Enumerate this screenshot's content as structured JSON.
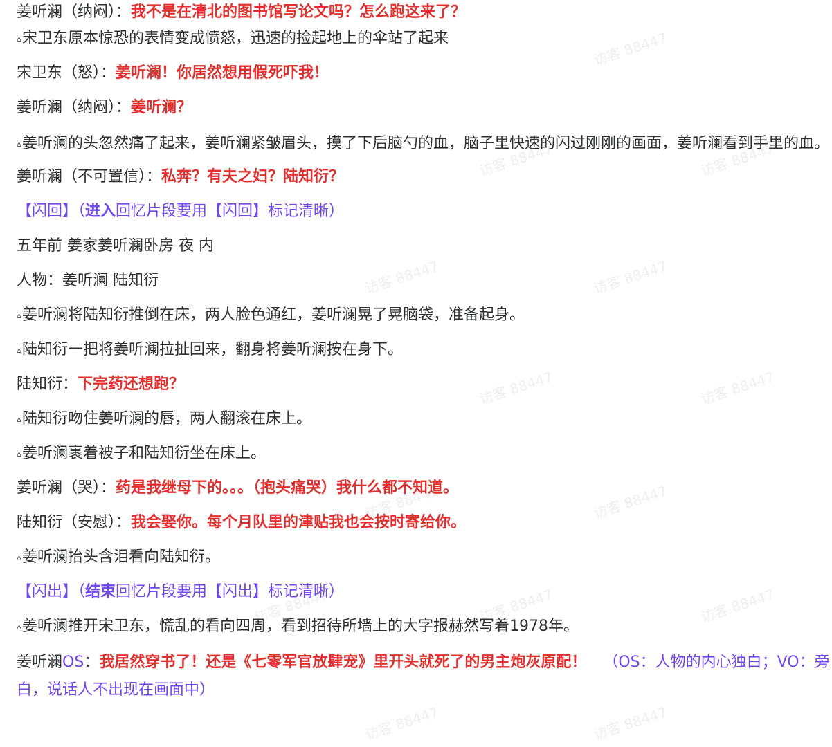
{
  "lines": {
    "l01": {
      "speaker": "姜听澜（纳闷）：",
      "dialogue": "我不是在清北的图书馆写论文吗？怎么跑这来了？"
    },
    "l02": {
      "marker": "▵",
      "action": "宋卫东原本惊恐的表情变成愤怒，迅速的捡起地上的伞站了起来"
    },
    "l03": {
      "speaker": "宋卫东（怒）：",
      "dialogue": "姜听澜！你居然想用假死吓我！"
    },
    "l04": {
      "speaker": "姜听澜（纳闷）：",
      "dialogue": "姜听澜？"
    },
    "l05": {
      "marker": "▵",
      "action": "姜听澜的头忽然痛了起来，姜听澜紧皱眉头，摸了下后脑勺的血，脑子里快速的闪过刚刚的画面，姜听澜看到手里的血。"
    },
    "l06": {
      "speaker": "姜听澜（不可置信）：",
      "dialogue": "私奔？有夫之妇？陆知衍？"
    },
    "l07": {
      "tag": "【闪回】",
      "open": "（",
      "bold": "进入",
      "rest": "回忆片段要用【闪回】标记清晰）"
    },
    "l08": {
      "text": "五年前 姜家姜听澜卧房 夜 内"
    },
    "l09": {
      "text": "人物：姜听澜 陆知衍"
    },
    "l10": {
      "marker": "▵",
      "action": "姜听澜将陆知衍推倒在床，两人脸色通红，姜听澜晃了晃脑袋，准备起身。"
    },
    "l11": {
      "marker": "▵",
      "action": "陆知衍一把将姜听澜拉扯回来，翻身将姜听澜按在身下。"
    },
    "l12": {
      "speaker": "陆知衍：",
      "dialogue": "下完药还想跑？"
    },
    "l13": {
      "marker": "▵",
      "action": "陆知衍吻住姜听澜的唇，两人翻滚在床上。"
    },
    "l14": {
      "marker": "▵",
      "action": "姜听澜裹着被子和陆知衍坐在床上。"
    },
    "l15": {
      "speaker": "姜听澜（哭）：",
      "dialogue": "药是我继母下的。。。（抱头痛哭）我什么都不知道。"
    },
    "l16": {
      "speaker": "陆知衍（安慰）：",
      "dialogue": "我会娶你。每个月队里的津贴我也会按时寄给你。"
    },
    "l17": {
      "marker": "▵",
      "action": "姜听澜抬头含泪看向陆知衍。"
    },
    "l18": {
      "tag": "【闪出】",
      "open": "（",
      "bold": "结束",
      "rest": "回忆片段要用【闪出】标记清晰）"
    },
    "l19": {
      "marker": "▵",
      "action": "姜听澜推开宋卫东，慌乱的看向四周，看到招待所墙上的大字报赫然写着1978年。"
    },
    "l20": {
      "speaker": "姜听澜",
      "os": "OS",
      "sep": "：",
      "dialogue": "我居然穿书了！还是《七零军官放肆宠》里开头就死了的男主炮灰原配！",
      "note": "（OS：人物的内心独白；VO：旁白，说话人不出现在画面中）"
    }
  },
  "watermark": "访客 88447",
  "colors": {
    "text": "#303133",
    "dialogue": "#e03131",
    "flash_tag": "#7048e8"
  }
}
